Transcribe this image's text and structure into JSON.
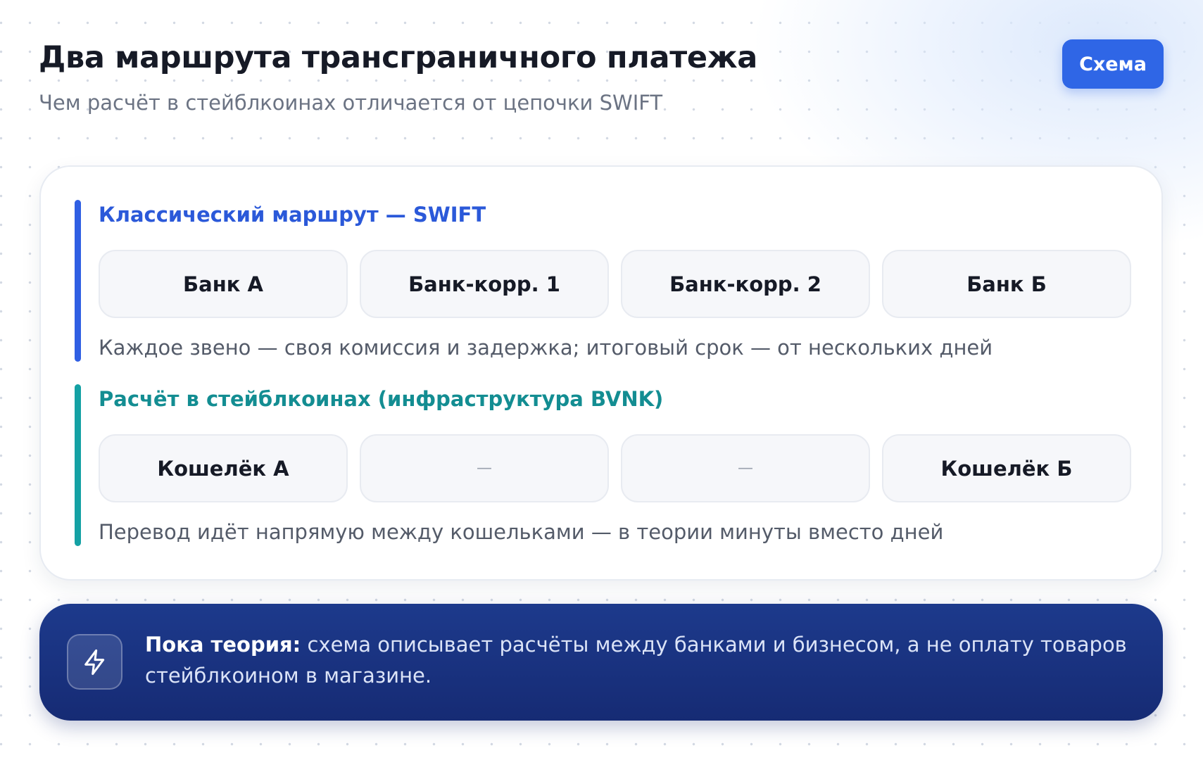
{
  "header": {
    "title": "Два маршрута трансграничного платежа",
    "subtitle": "Чем расчёт в стейблкоинах отличается от цепочки SWIFT",
    "scheme_button_label": "Схема"
  },
  "routes": {
    "swift": {
      "title": "Классический маршрут — SWIFT",
      "nodes": [
        "Банк А",
        "Банк-корр. 1",
        "Банк-корр. 2",
        "Банк Б"
      ],
      "note": "Каждое звено — своя комиссия и задержка; итоговый срок — от нескольких дней"
    },
    "stablecoin": {
      "title": "Расчёт в стейблкоинах (инфраструктура BVNK)",
      "nodes": [
        "Кошелёк А",
        "—",
        "—",
        "Кошелёк Б"
      ],
      "note": "Перевод идёт напрямую между кошельками — в теории минуты вместо дней"
    }
  },
  "notice": {
    "icon": "lightning-icon",
    "label": "Пока теория:",
    "text": "схема описывает расчёты между банками и бизнесом, а не оплату товаров стейблкоином в магазине."
  },
  "colors": {
    "accent": "#2f66e6",
    "swift": "#2b59d9",
    "stablecoin": "#138d92",
    "banner": "#1d3a8c"
  }
}
